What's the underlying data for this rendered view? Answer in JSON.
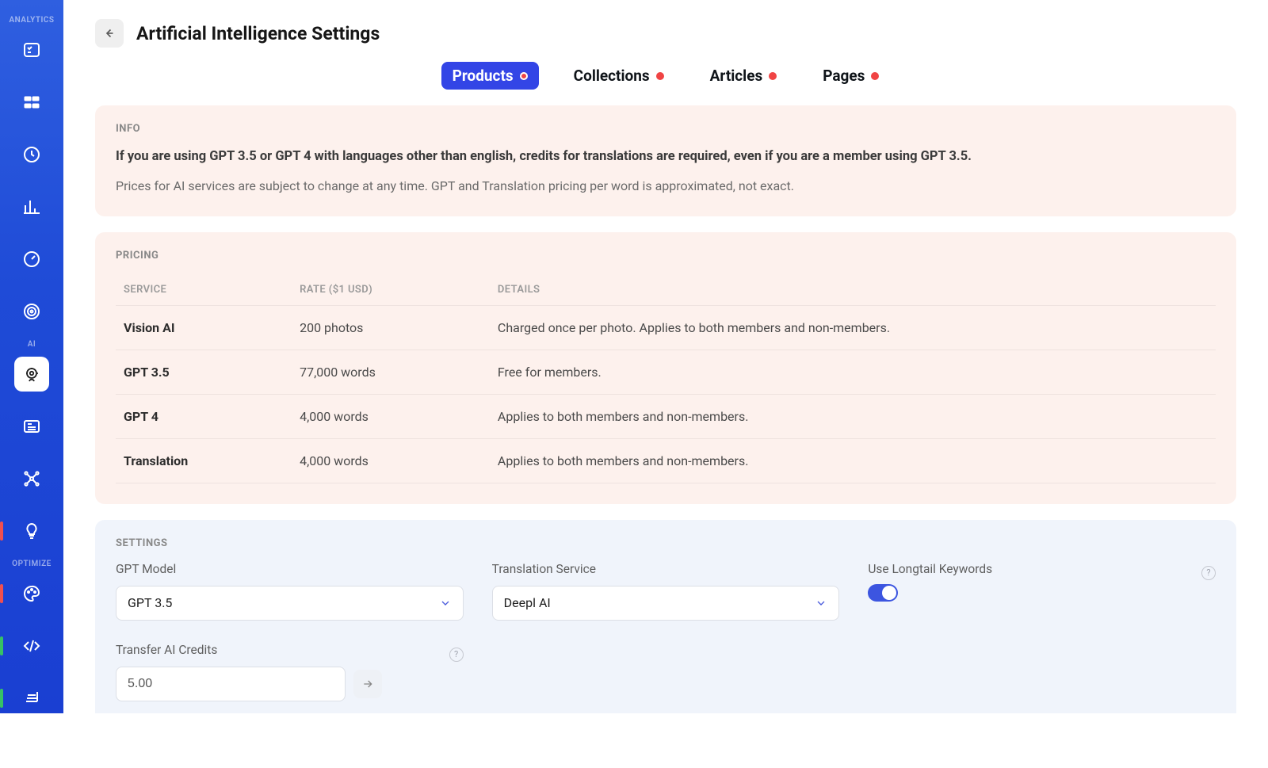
{
  "sidebar": {
    "sections": {
      "analytics_label": "ANALYTICS",
      "ai_label": "AI",
      "optimize_label": "OPTIMIZE"
    }
  },
  "header": {
    "title": "Artificial Intelligence Settings"
  },
  "tabs": [
    {
      "label": "Products",
      "active": true
    },
    {
      "label": "Collections",
      "active": false
    },
    {
      "label": "Articles",
      "active": false
    },
    {
      "label": "Pages",
      "active": false
    }
  ],
  "info": {
    "heading": "INFO",
    "line1": "If you are using GPT 3.5 or GPT 4 with languages other than english, credits for translations are required, even if you are a member using GPT 3.5.",
    "line2": "Prices for AI services are subject to change at any time. GPT and Translation pricing per word is approximated, not exact."
  },
  "pricing": {
    "heading": "PRICING",
    "columns": {
      "service": "SERVICE",
      "rate": "RATE ($1 USD)",
      "details": "DETAILS"
    },
    "rows": [
      {
        "service": "Vision AI",
        "rate": "200 photos",
        "details": "Charged once per photo. Applies to both members and non-members."
      },
      {
        "service": "GPT 3.5",
        "rate": "77,000 words",
        "details": "Free for members."
      },
      {
        "service": "GPT 4",
        "rate": "4,000 words",
        "details": "Applies to both members and non-members."
      },
      {
        "service": "Translation",
        "rate": "4,000 words",
        "details": "Applies to both members and non-members."
      }
    ]
  },
  "settings": {
    "heading": "SETTINGS",
    "gpt_model": {
      "label": "GPT Model",
      "value": "GPT 3.5"
    },
    "translation_service": {
      "label": "Translation Service",
      "value": "Deepl AI"
    },
    "longtail": {
      "label": "Use Longtail Keywords",
      "value": true
    },
    "transfer": {
      "label": "Transfer AI Credits",
      "value": "5.00"
    }
  }
}
